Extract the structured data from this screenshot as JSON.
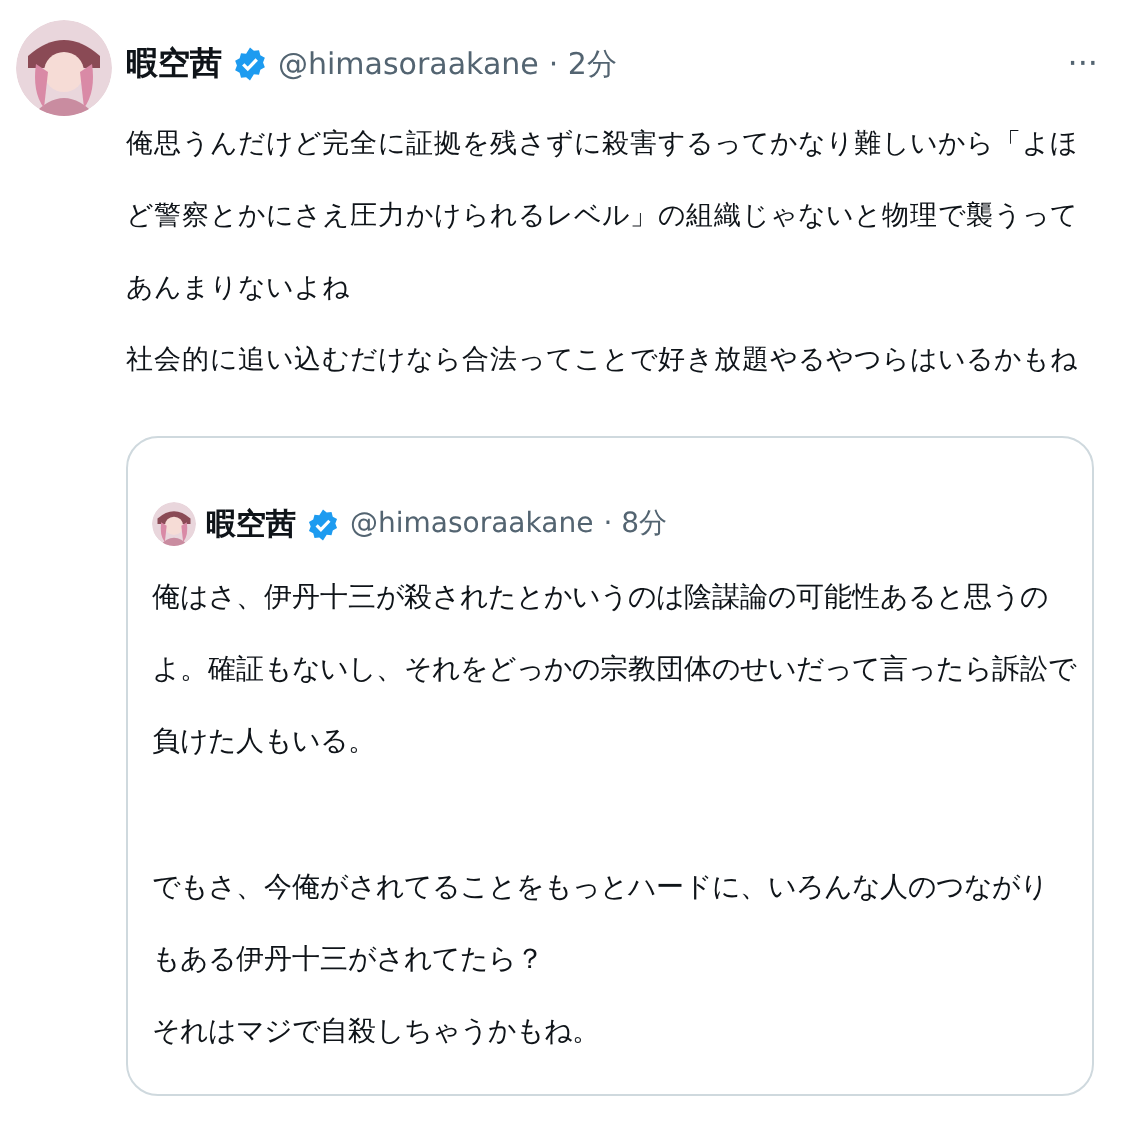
{
  "tweet": {
    "name": "暇空茜",
    "verified": true,
    "handle": "@himasoraakane",
    "time": "· 2分",
    "more": "···",
    "paragraphs": [
      "俺思うんだけど完全に証拠を残さずに殺害するってかなり難しいから「よほど警察とかにさえ圧力かけられるレベル」の組織じゃないと物理で襲うってあんまりないよね",
      "社会的に追い込むだけなら合法ってことで好き放題やるやつらはいるかもね"
    ],
    "quote": {
      "name": "暇空茜",
      "verified": true,
      "handle": "@himasoraakane",
      "time": "· 8分",
      "paragraphs": [
        [
          "俺はさ、伊丹十三が殺されたとかいうのは陰謀論の可能性あると思うのよ。確証もないし、それをどっかの宗教団体のせいだって言ったら訴訟で負けた人もいる。"
        ],
        [
          "でもさ、今俺がされてることをもっとハードに、いろんな人のつながり",
          "もある伊丹十三がされてたら？",
          "それはマジで自殺しちゃうかもね。"
        ]
      ]
    }
  }
}
